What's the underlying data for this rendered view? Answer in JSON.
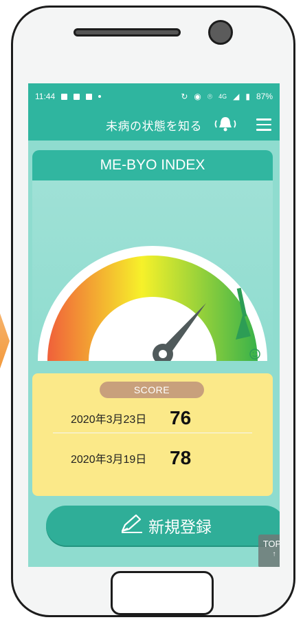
{
  "status_bar": {
    "time": "11:44",
    "network": "4G",
    "battery": "87%"
  },
  "app_bar": {
    "title": "未病の状態を知る",
    "bell_icon": "bell-icon",
    "menu_icon": "hamburger-menu-icon"
  },
  "index_card": {
    "title": "ME-BYO INDEX"
  },
  "gauge": {
    "colors": [
      "#f0603a",
      "#f6f12a",
      "#39b24a"
    ],
    "indicator_icon": "smiley-icon"
  },
  "score": {
    "label": "SCORE",
    "entries": [
      {
        "date": "2020年3月23日",
        "value": "76"
      },
      {
        "date": "2020年3月19日",
        "value": "78"
      }
    ]
  },
  "register_button": {
    "label": "新規登録",
    "icon": "pencil-icon"
  },
  "top_button": {
    "label": "TOP"
  }
}
